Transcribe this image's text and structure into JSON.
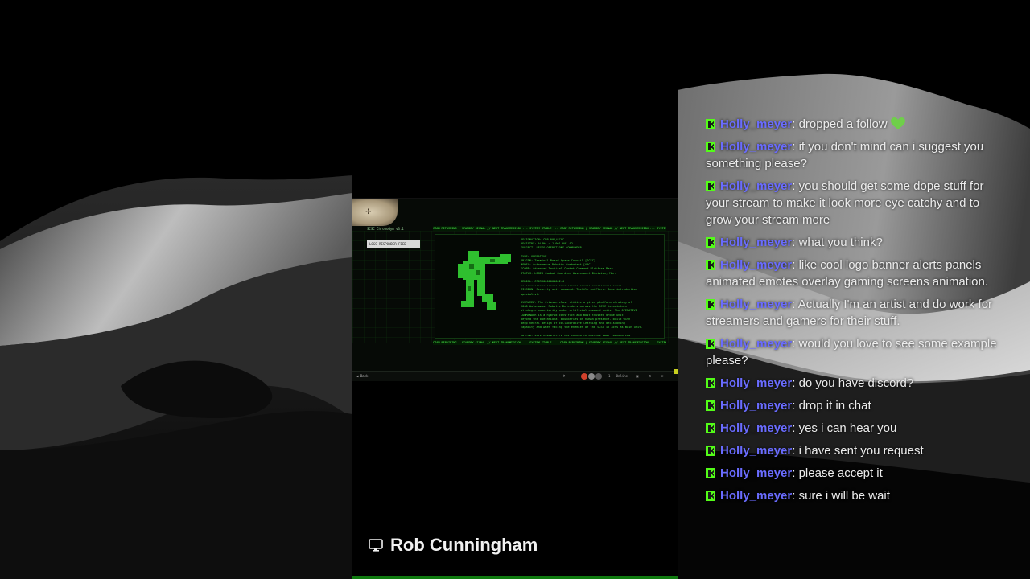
{
  "streamer": {
    "name": "Rob Cunningham",
    "icon": "monitor-icon"
  },
  "stream_screen": {
    "window_title": "SCSC Chronodyn v3.1",
    "side_button": "LOGS RESPONDER FEED",
    "ticker_text": "CTAM REPAIRING | STANDBY SIGNAL // NEXT TRANSMISSION ... SYSTEM STABLE ... CTAM REPAIRING | STANDBY SIGNAL // NEXT TRANSMISSION ... SYSTEM STABLE ... CTAM REPAIRING",
    "terminal_lines": [
      "DESIGNATION: CRB-001/SCSC",
      "REGISTRY: ALPHA                          v.1.001.001.02",
      "SUBJECT: LEGIO OPERATIONS COMMANDER",
      "----------------------------------------------------------",
      "TYPE: OPERATIVE",
      "ORIGIN: Terminal Board Space Council [SCSC]",
      "MODEL: Autonomous Robotic Combatant [ARC]",
      "SCOPE: Advanced Tactical Combat Command Platform Base",
      "STATUS: LEGIO Combat Guardian Assessment Division, Mars",
      "",
      "SERIAL: CF6990000001002-4",
      "----------------------------------------------------------",
      "MISSION: Security unit command. Tactile uniflora. Base introduction",
      "specialist.",
      "",
      "OVERVIEW: The Crimson class utilize a given platform strategy of",
      "ROGO Autonomous Robotic Defenders across the SCSC to maintain",
      "strategic superiority under artificial command units. The OPERATIVE",
      "COMMANDER is a hybrid construct and most trusted drone unit",
      "beyond the operational boundaries of human presence. Built with",
      "deep neural design of collaborative learning and decisioning",
      "capacity and when facing the enemies of the SCSC it acts as main unit.",
      "",
      "ORIGIN: this scene/title was coined in outline seen. Beyond the ...",
      "and strategic unit response"
    ],
    "taskbar": {
      "start_label": "Back",
      "status_label": "1 - Online",
      "indicator_colors": [
        "#d0412b",
        "#8a8a8a",
        "#5a5a5a"
      ]
    }
  },
  "chat": {
    "platform_icon": "kick-logo-icon",
    "accent_color": "#53fc18",
    "username_color": "#6a6cff",
    "messages": [
      {
        "user": "Holly_meyer",
        "text": "dropped a follow",
        "emoji": "green-heart-icon"
      },
      {
        "user": "Holly_meyer",
        "text": "if you don't mind can i suggest you something please?"
      },
      {
        "user": "Holly_meyer",
        "text": "you should get some dope stuff for your stream to make it look more eye catchy and to grow your stream more"
      },
      {
        "user": "Holly_meyer",
        "text": "what you think?"
      },
      {
        "user": "Holly_meyer",
        "text": "like cool logo banner alerts panels animated emotes overlay gaming screens animation."
      },
      {
        "user": "Holly_meyer",
        "text": "Actually I'm an artist and do work for streamers and gamers for their stuff."
      },
      {
        "user": "Holly_meyer",
        "text": "would you love to see some example please?"
      },
      {
        "user": "Holly_meyer",
        "text": "do you have discord?"
      },
      {
        "user": "Holly_meyer",
        "text": "drop it in chat"
      },
      {
        "user": "Holly_meyer",
        "text": "yes i can hear you"
      },
      {
        "user": "Holly_meyer",
        "text": "i have sent you request"
      },
      {
        "user": "Holly_meyer",
        "text": "please accept it"
      },
      {
        "user": "Holly_meyer",
        "text": "sure i will be wait"
      }
    ]
  }
}
